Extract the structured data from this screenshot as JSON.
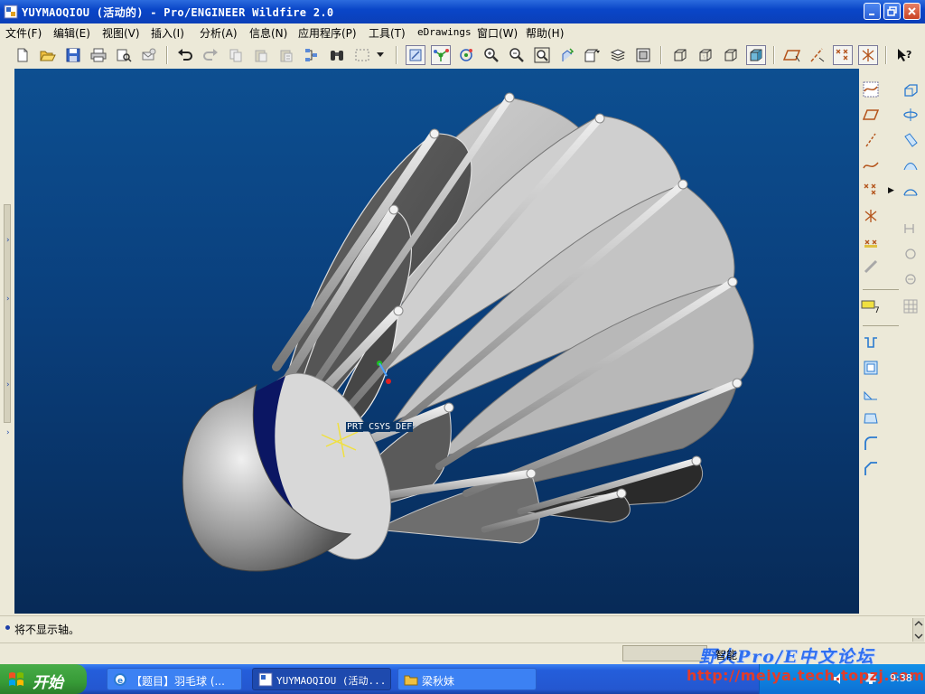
{
  "window": {
    "title": "YUYMAOQIOU (活动的) - Pro/ENGINEER Wildfire 2.0"
  },
  "menu": {
    "items": [
      {
        "label": "文件(F)"
      },
      {
        "label": "编辑(E)"
      },
      {
        "label": "视图(V)"
      },
      {
        "label": "插入(I)"
      },
      {
        "label": "分析(A)"
      },
      {
        "label": "信息(N)"
      },
      {
        "label": "应用程序(P)"
      },
      {
        "label": "工具(T)"
      },
      {
        "label": "eDrawings"
      },
      {
        "label": "窗口(W)"
      },
      {
        "label": "帮助(H)"
      }
    ]
  },
  "viewport": {
    "csys_label": "PRT_CSYS_DEF",
    "colors": {
      "background_top": "#0d4f91",
      "background_bottom": "#072a57",
      "model_gray": "#9a9a9a",
      "band_navy": "#0b1663"
    }
  },
  "message": {
    "text": "将不显示轴。"
  },
  "status": {
    "smart_label": "智能",
    "forum_watermark": "野火Pro/E中文论坛",
    "url_watermark": "http://meiya.tech.topzj.com"
  },
  "taskbar": {
    "start_label": "开始",
    "items": [
      {
        "label": "【题目】羽毛球 (...",
        "icon": "ie-icon"
      },
      {
        "label": "YUYMAOQIOU (活动...",
        "icon": "proe-icon"
      },
      {
        "label": "梁秋妹",
        "icon": "folder-icon"
      }
    ],
    "clock": "9:38"
  }
}
